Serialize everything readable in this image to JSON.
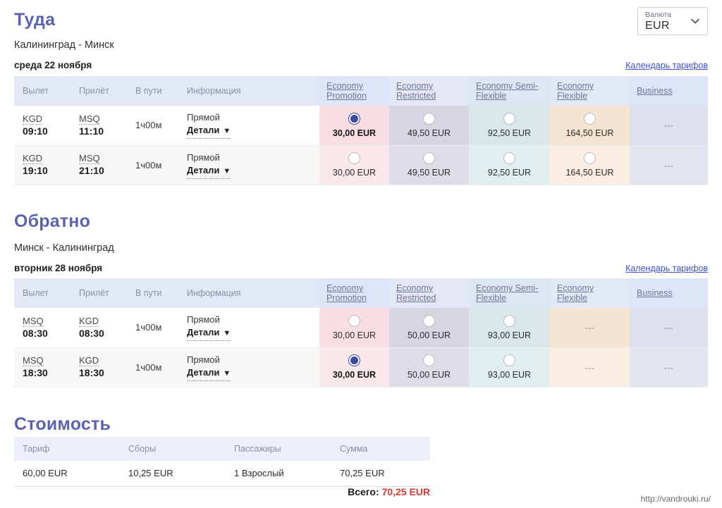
{
  "currency_selector": {
    "label": "Валюта",
    "value": "EUR",
    "chevron_icon": "chevron-down-icon"
  },
  "outbound": {
    "title": "Туда",
    "route": "Калининград - Минск",
    "date": "среда 22 ноября",
    "calendar_link": "Календарь тарифов",
    "columns": {
      "departure": "Вылет",
      "arrival": "Прилёт",
      "duration": "В пути",
      "info": "Информация"
    },
    "fare_columns": [
      {
        "line1": "Economy",
        "line2": "Promotion"
      },
      {
        "line1": "Economy",
        "line2": "Restricted"
      },
      {
        "line1": "Economy Semi-",
        "line2": "Flexible"
      },
      {
        "line1": "Economy",
        "line2": "Flexible"
      },
      {
        "line1": "Business",
        "line2": ""
      }
    ],
    "rows": [
      {
        "dep_code": "KGD",
        "dep_time": "09:10",
        "arr_code": "MSQ",
        "arr_time": "11:10",
        "duration": "1ч00м",
        "info_direct": "Прямой",
        "info_details": "Детали",
        "fares": [
          {
            "price": "30,00 EUR",
            "selected": true,
            "available": true
          },
          {
            "price": "49,50 EUR",
            "selected": false,
            "available": true
          },
          {
            "price": "92,50 EUR",
            "selected": false,
            "available": true
          },
          {
            "price": "164,50 EUR",
            "selected": false,
            "available": true
          },
          {
            "price": "---",
            "selected": false,
            "available": false
          }
        ]
      },
      {
        "dep_code": "KGD",
        "dep_time": "19:10",
        "arr_code": "MSQ",
        "arr_time": "21:10",
        "duration": "1ч00м",
        "info_direct": "Прямой",
        "info_details": "Детали",
        "fares": [
          {
            "price": "30,00 EUR",
            "selected": false,
            "available": true
          },
          {
            "price": "49,50 EUR",
            "selected": false,
            "available": true
          },
          {
            "price": "92,50 EUR",
            "selected": false,
            "available": true
          },
          {
            "price": "164,50 EUR",
            "selected": false,
            "available": true
          },
          {
            "price": "---",
            "selected": false,
            "available": false
          }
        ]
      }
    ]
  },
  "inbound": {
    "title": "Обратно",
    "route": "Минск - Калининград",
    "date": "вторник 28 ноября",
    "calendar_link": "Календарь тарифов",
    "columns": {
      "departure": "Вылет",
      "arrival": "Прилёт",
      "duration": "В пути",
      "info": "Информация"
    },
    "fare_columns": [
      {
        "line1": "Economy",
        "line2": "Promotion"
      },
      {
        "line1": "Economy",
        "line2": "Restricted"
      },
      {
        "line1": "Economy Semi-",
        "line2": "Flexible"
      },
      {
        "line1": "Economy",
        "line2": "Flexible"
      },
      {
        "line1": "Business",
        "line2": ""
      }
    ],
    "rows": [
      {
        "dep_code": "MSQ",
        "dep_time": "08:30",
        "arr_code": "KGD",
        "arr_time": "08:30",
        "duration": "1ч00м",
        "info_direct": "Прямой",
        "info_details": "Детали",
        "fares": [
          {
            "price": "30,00 EUR",
            "selected": false,
            "available": true
          },
          {
            "price": "50,00 EUR",
            "selected": false,
            "available": true
          },
          {
            "price": "93,00 EUR",
            "selected": false,
            "available": true
          },
          {
            "price": "---",
            "selected": false,
            "available": false
          },
          {
            "price": "---",
            "selected": false,
            "available": false
          }
        ]
      },
      {
        "dep_code": "MSQ",
        "dep_time": "18:30",
        "arr_code": "KGD",
        "arr_time": "18:30",
        "duration": "1ч00м",
        "info_direct": "Прямой",
        "info_details": "Детали",
        "fares": [
          {
            "price": "30,00 EUR",
            "selected": true,
            "available": true
          },
          {
            "price": "50,00 EUR",
            "selected": false,
            "available": true
          },
          {
            "price": "93,00 EUR",
            "selected": false,
            "available": true
          },
          {
            "price": "---",
            "selected": false,
            "available": false
          },
          {
            "price": "---",
            "selected": false,
            "available": false
          }
        ]
      }
    ]
  },
  "cost": {
    "title": "Стоимость",
    "columns": [
      "Тариф",
      "Сборы",
      "Пассажиры",
      "Сумма"
    ],
    "row": [
      "60,00 EUR",
      "10,25 EUR",
      "1 Взрослый",
      "70,25 EUR"
    ],
    "total_label": "Всего:",
    "total_value": "70,25 EUR"
  },
  "watermark": "http://vandrouki.ru/",
  "colors": {
    "heading": "#5a63b0",
    "link": "#3d52c4",
    "total": "#d33a33",
    "selected_radio": "#3b4a9e"
  }
}
